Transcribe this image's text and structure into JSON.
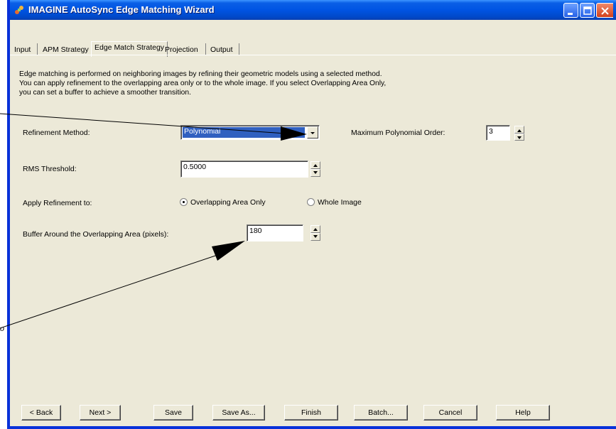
{
  "window": {
    "title": "IMAGINE AutoSync Edge Matching Wizard",
    "accent": "#0054e3"
  },
  "tabs": [
    {
      "label": "Input"
    },
    {
      "label": "APM Strategy"
    },
    {
      "label": "Edge Match Strategy",
      "active": true
    },
    {
      "label": "Projection"
    },
    {
      "label": "Output"
    }
  ],
  "description": {
    "line1": "Edge matching is performed on neighboring images by refining their geometric models using a selected method.",
    "line2": "You can apply refinement to the overlapping area only or to the whole image. If you select Overlapping Area Only,",
    "line3": "you can set a buffer to achieve a smoother transition."
  },
  "form": {
    "refinement_method_label": "Refinement Method:",
    "refinement_method_value": "Polynomial",
    "max_poly_order_label": "Maximum Polynomial Order:",
    "max_poly_order_value": "3",
    "rms_threshold_label": "RMS Threshold:",
    "rms_threshold_value": "0.5000",
    "apply_refinement_label": "Apply Refinement to:",
    "radio_overlap_label": "Overlapping Area Only",
    "radio_overlap_selected": true,
    "radio_whole_label": "Whole Image",
    "buffer_label": "Buffer Around the Overlapping Area (pixels):",
    "buffer_value": "180"
  },
  "buttons": {
    "back": "< Back",
    "next": "Next >",
    "save": "Save",
    "save_as": "Save As...",
    "finish": "Finish",
    "batch": "Batch...",
    "cancel": "Cancel",
    "help": "Help"
  },
  "callout": {
    "mark": "o"
  }
}
